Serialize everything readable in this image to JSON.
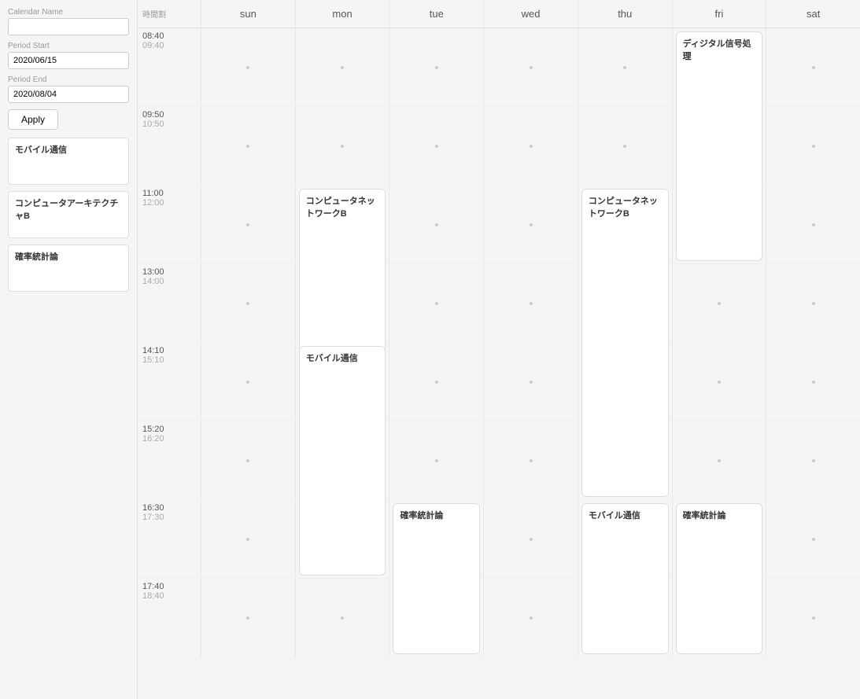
{
  "sidebar": {
    "calendar_name_label": "Calendar Name",
    "period_start_label": "Period Start",
    "period_start_value": "2020/06/15",
    "period_end_label": "Period End",
    "period_end_value": "2020/08/04",
    "apply_label": "Apply",
    "jikanwari_label": "時間割",
    "course_items": [
      {
        "name": "モバイル通信"
      },
      {
        "name": "コンピュータアーキテクチャB"
      },
      {
        "name": "確率統計論"
      }
    ]
  },
  "calendar": {
    "days": [
      "sun",
      "mon",
      "tue",
      "wed",
      "thu",
      "fri",
      "sat"
    ],
    "time_slots": [
      {
        "start": "08:40",
        "end": "09:40"
      },
      {
        "start": "09:50",
        "end": "10:50"
      },
      {
        "start": "11:00",
        "end": "12:00"
      },
      {
        "start": "13:00",
        "end": "14:00"
      },
      {
        "start": "14:10",
        "end": "15:10"
      },
      {
        "start": "15:20",
        "end": "16:20"
      },
      {
        "start": "16:30",
        "end": "17:30"
      },
      {
        "start": "17:40",
        "end": "18:40"
      }
    ],
    "events": [
      {
        "day": 5,
        "slot_start": 0,
        "slot_span": 3,
        "label": "ディジタル信号処理"
      },
      {
        "day": 1,
        "slot_start": 2,
        "slot_span": 4,
        "label": "コンピュータネットワークB"
      },
      {
        "day": 4,
        "slot_start": 2,
        "slot_span": 4,
        "label": "コンピュータネットワークB"
      },
      {
        "day": 1,
        "slot_start": 4,
        "slot_span": 3,
        "label": "モバイル通信"
      },
      {
        "day": 2,
        "slot_start": 6,
        "slot_span": 2,
        "label": "確率統計論"
      },
      {
        "day": 4,
        "slot_start": 6,
        "slot_span": 2,
        "label": "モバイル通信"
      },
      {
        "day": 5,
        "slot_start": 6,
        "slot_span": 2,
        "label": "確率統計論"
      }
    ]
  }
}
